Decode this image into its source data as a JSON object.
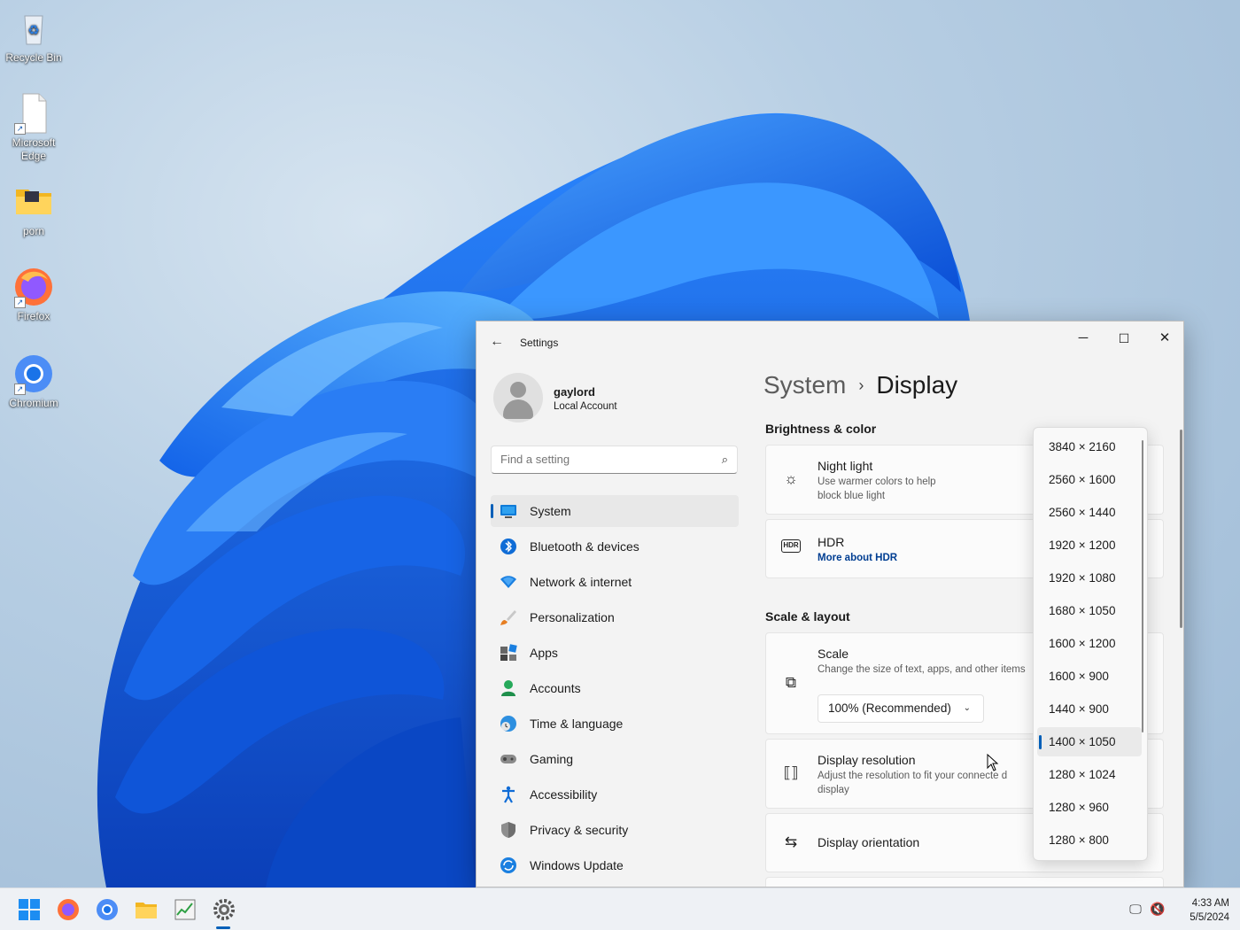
{
  "desktop": {
    "icons": [
      {
        "label": "Recycle Bin",
        "icon": "recycle-bin-icon"
      },
      {
        "label": "Microsoft\nEdge",
        "icon": "blank-file-icon"
      },
      {
        "label": "porn",
        "icon": "folder-icon"
      },
      {
        "label": "Firefox",
        "icon": "firefox-icon"
      },
      {
        "label": "Chromium",
        "icon": "chromium-icon"
      }
    ]
  },
  "window": {
    "title": "Settings",
    "controls": {
      "minimize": "─",
      "maximize": "☐",
      "close": "✕"
    }
  },
  "user": {
    "name": "gaylord",
    "account_type": "Local Account"
  },
  "search": {
    "placeholder": "Find a setting"
  },
  "nav": [
    {
      "label": "System",
      "icon": "monitor-icon",
      "active": true
    },
    {
      "label": "Bluetooth & devices",
      "icon": "bluetooth-icon"
    },
    {
      "label": "Network & internet",
      "icon": "wifi-icon"
    },
    {
      "label": "Personalization",
      "icon": "brush-icon"
    },
    {
      "label": "Apps",
      "icon": "apps-icon"
    },
    {
      "label": "Accounts",
      "icon": "person-icon"
    },
    {
      "label": "Time & language",
      "icon": "globe-clock-icon"
    },
    {
      "label": "Gaming",
      "icon": "gamepad-icon"
    },
    {
      "label": "Accessibility",
      "icon": "accessibility-icon"
    },
    {
      "label": "Privacy & security",
      "icon": "shield-icon"
    },
    {
      "label": "Windows Update",
      "icon": "update-icon"
    }
  ],
  "breadcrumb": {
    "parent": "System",
    "separator": "›",
    "current": "Display"
  },
  "sections": {
    "brightness": {
      "heading": "Brightness & color",
      "night_light": {
        "title": "Night light",
        "subtitle": "Use warmer colors to help block blue light"
      },
      "hdr": {
        "title": "HDR",
        "link": "More about HDR",
        "icon_text": "HDR"
      }
    },
    "scale_layout": {
      "heading": "Scale & layout",
      "scale": {
        "title": "Scale",
        "subtitle": "Change the size of text, apps, and other items",
        "value": "100% (Recommended)"
      },
      "resolution": {
        "title": "Display resolution",
        "subtitle": "Adjust the resolution to fit your connecte d display"
      },
      "orientation": {
        "title": "Display orientation"
      }
    }
  },
  "resolution_options": {
    "items": [
      "3840 × 2160",
      "2560 × 1600",
      "2560 × 1440",
      "1920 × 1200",
      "1920 × 1080",
      "1680 × 1050",
      "1600 × 1200",
      "1600 × 900",
      "1440 × 900",
      "1400 × 1050",
      "1280 × 1024",
      "1280 × 960",
      "1280 × 800"
    ],
    "selected": "1400 × 1050"
  },
  "taskbar": {
    "apps": [
      "start-icon",
      "firefox-icon",
      "chromium-icon",
      "file-explorer-icon",
      "task-manager-icon",
      "settings-gear-icon"
    ],
    "time": "4:33 AM",
    "date": "5/5/2024"
  },
  "colors": {
    "accent": "#005fb8",
    "link": "#003e92",
    "wallpaper_blue": "#1a6ef5"
  }
}
